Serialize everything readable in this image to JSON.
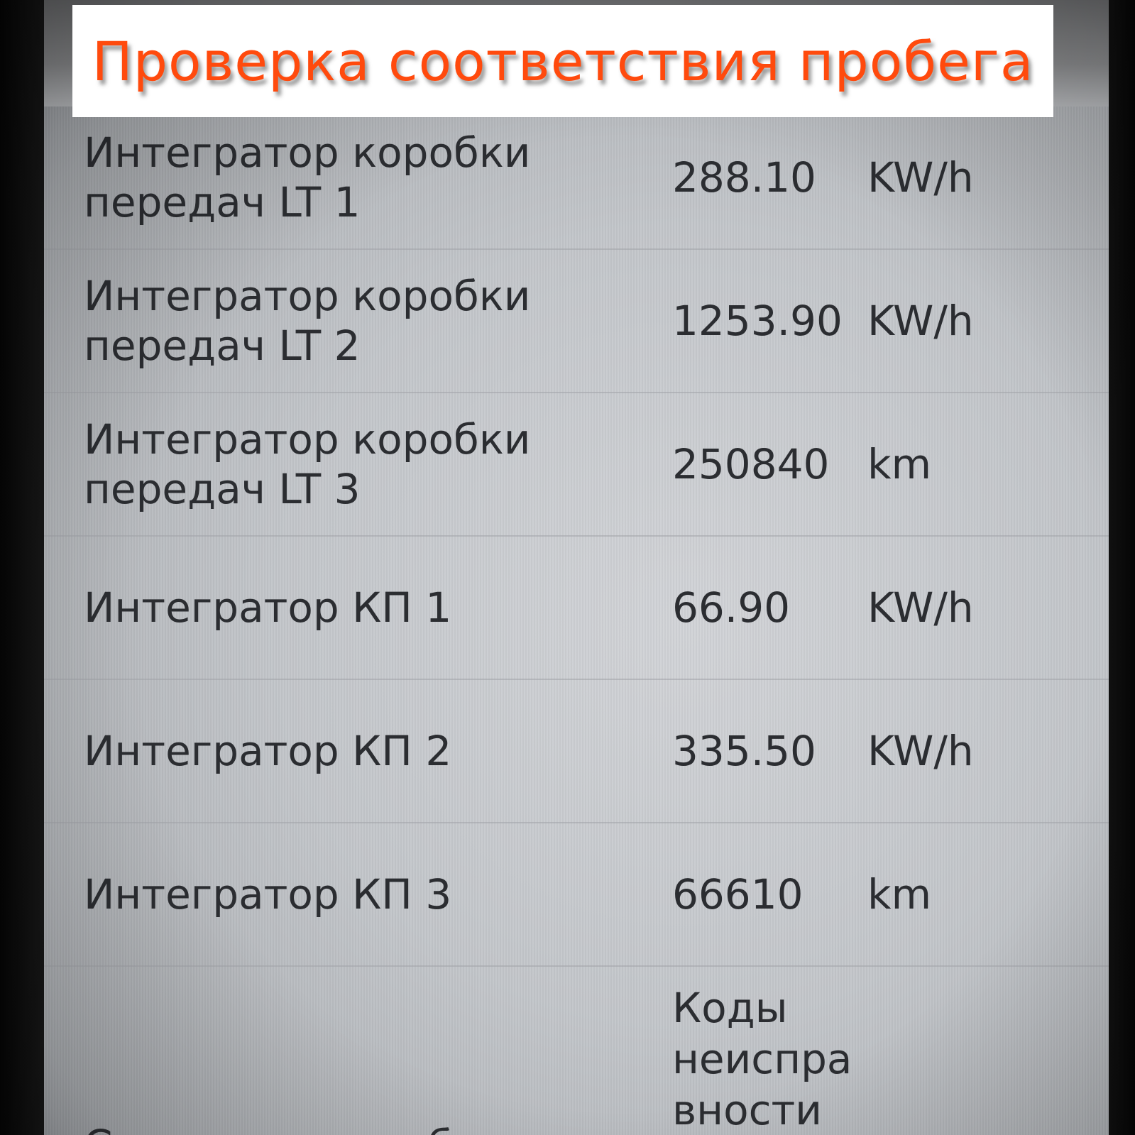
{
  "banner": {
    "title": "Проверка соответствия пробега"
  },
  "rows": [
    {
      "name_line1": "Интегратор коробки",
      "name_line2": "передач LT 1",
      "value": "288.10",
      "unit": "KW/h"
    },
    {
      "name_line1": "Интегратор коробки",
      "name_line2": "передач LT 2",
      "value": "1253.90",
      "unit": "KW/h"
    },
    {
      "name_line1": "Интегратор коробки",
      "name_line2": "передач LT 3",
      "value": "250840",
      "unit": "km"
    },
    {
      "name": "Интегратор КП 1",
      "value": "66.90",
      "unit": "KW/h"
    },
    {
      "name": "Интегратор КП 2",
      "value": "335.50",
      "unit": "KW/h"
    },
    {
      "name": "Интегратор КП 3",
      "value": "66610",
      "unit": "km"
    }
  ],
  "last_row": {
    "name": "Состояние коробки передач",
    "value_line1": "Коды",
    "value_line2": "неиспра",
    "value_line3": "вности"
  },
  "colors": {
    "banner_text": "#ff4a0d",
    "banner_bg": "#ffffff",
    "text": "#2b2d31",
    "screen_bg": "#c3c6ca"
  }
}
